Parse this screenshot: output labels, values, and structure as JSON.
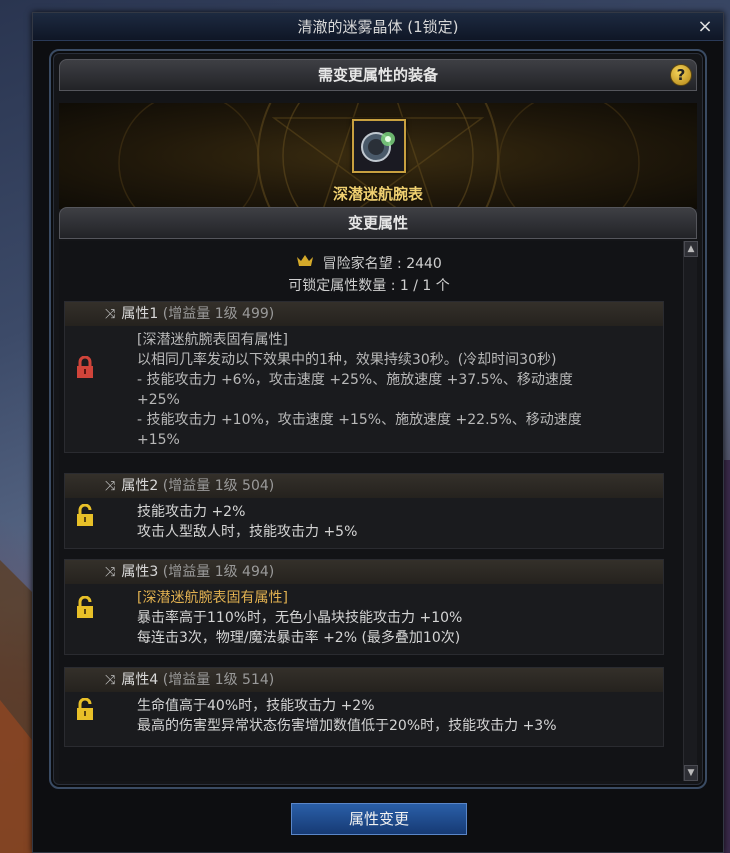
{
  "window": {
    "title": "清澈的迷雾晶体 (1锁定)",
    "close_label": "×"
  },
  "equipment_section": {
    "header": "需变更属性的装备",
    "help_label": "?",
    "item_name": "深潜迷航腕表"
  },
  "change_section": {
    "header": "变更属性",
    "fame_label": "冒险家名望 : 2440",
    "lockable_label": "可锁定属性数量 :   1 / 1 个"
  },
  "attributes": [
    {
      "title": "属性1",
      "meta": "(增益量 1级 499)",
      "locked": true,
      "lines": [
        {
          "text": "[深潜迷航腕表固有属性]",
          "style": "grayish"
        },
        {
          "text": "以相同几率发动以下效果中的1种，效果持续30秒。(冷却时间30秒)",
          "style": "grayish"
        },
        {
          "text": "- 技能攻击力 +6%，攻击速度 +25%、施放速度 +37.5%、移动速度",
          "style": "grayish"
        },
        {
          "text": "+25%",
          "style": "grayish"
        },
        {
          "text": "- 技能攻击力 +10%，攻击速度 +15%、施放速度 +22.5%、移动速度",
          "style": "grayish"
        },
        {
          "text": "+15%",
          "style": "grayish"
        }
      ]
    },
    {
      "title": "属性2",
      "meta": "(增益量 1级 504)",
      "locked": false,
      "lines": [
        {
          "text": "技能攻击力 +2%",
          "style": ""
        },
        {
          "text": "攻击人型敌人时，技能攻击力 +5%",
          "style": ""
        }
      ]
    },
    {
      "title": "属性3",
      "meta": "(增益量 1级 494)",
      "locked": false,
      "lines": [
        {
          "text": "[深潜迷航腕表固有属性]",
          "style": "gold"
        },
        {
          "text": "暴击率高于110%时，无色小晶块技能攻击力 +10%",
          "style": ""
        },
        {
          "text": "每连击3次，物理/魔法暴击率 +2% (最多叠加10次)",
          "style": ""
        }
      ]
    },
    {
      "title": "属性4",
      "meta": "(增益量 1级 514)",
      "locked": false,
      "lines": [
        {
          "text": "生命值高于40%时，技能攻击力 +2%",
          "style": ""
        },
        {
          "text": "最高的伤害型异常状态伤害增加数值低于20%时，技能攻击力 +3%",
          "style": ""
        }
      ]
    }
  ],
  "icons": {
    "fame": "fame-icon",
    "shuffle": "shuffle-icon",
    "lock_closed": "lock-closed-icon",
    "lock_open": "lock-open-icon"
  },
  "colors": {
    "lock_closed": "#d0443a",
    "lock_open": "#e8c028",
    "gold_text": "#f0d070",
    "button_blue": "#1f4e8f"
  },
  "change_button": {
    "label": "属性变更"
  },
  "scroll": {
    "up": "▲",
    "down": "▼"
  }
}
